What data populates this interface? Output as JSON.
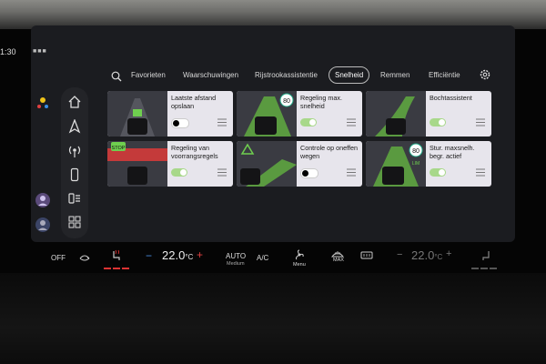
{
  "status": {
    "time": "1:30",
    "dots": "■■■"
  },
  "tabs": [
    {
      "label": "Favorieten",
      "active": false
    },
    {
      "label": "Waarschuwingen",
      "active": false
    },
    {
      "label": "Rijstrookassistentie",
      "active": false
    },
    {
      "label": "Snelheid",
      "active": true
    },
    {
      "label": "Remmen",
      "active": false
    },
    {
      "label": "Efficiëntie",
      "active": false
    }
  ],
  "cards": [
    {
      "title": "Laatste afstand opslaan",
      "toggle": "off"
    },
    {
      "title": "Regeling max. snelheid",
      "toggle": "on",
      "badge": "80"
    },
    {
      "title": "Bochtassistent",
      "toggle": "on"
    },
    {
      "title": "Regeling van voorrangsregels",
      "toggle": "on",
      "badge": "STOP"
    },
    {
      "title": "Controle op oneffen wegen",
      "toggle": "off"
    },
    {
      "title": "Stur. maxsnelh. begr. actief",
      "toggle": "on",
      "badge": "80",
      "badge2": "LIM"
    }
  ],
  "climate": {
    "off_label": "OFF",
    "left_temp": "22.0",
    "left_unit": "°C",
    "minus": "−",
    "plus": "+",
    "auto_label": "AUTO",
    "auto_sub": "Medium",
    "ac_label": "A/C",
    "menu_label": "Menu",
    "max_label": "MAX",
    "right_temp": "22.0",
    "right_unit": "°C"
  },
  "colors": {
    "accent_green": "#6fcf4f",
    "toggle_on": "#a8d88a",
    "heat_red": "#d33333"
  }
}
